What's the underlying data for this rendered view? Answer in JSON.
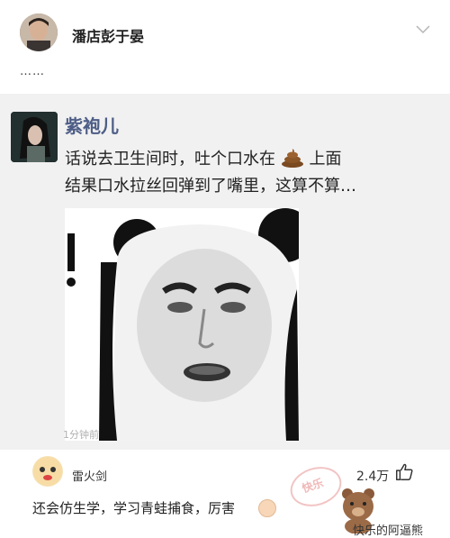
{
  "post": {
    "author": "潘店彭于晏",
    "text": "……"
  },
  "card": {
    "name": "紫袍儿",
    "line1": "话说去卫生间时，吐个口水在",
    "line1_end": "上面",
    "line2": "结果口水拉丝回弹到了嘴里，这算不算…",
    "time": "1分钟前"
  },
  "comment": {
    "author": "雷火剑",
    "likes": "2.4万",
    "text": "还会仿生学，学习青蛙捕食，厉害"
  },
  "watermark": "快乐的阿逼熊",
  "icons": {
    "chevron": "chevron-down-icon",
    "poop": "poop-icon",
    "like": "thumbs-up-icon",
    "emoji": "smile-emoji-icon"
  },
  "colors": {
    "name_blue": "#4d5d86",
    "card_bg": "#f1f1f1"
  }
}
